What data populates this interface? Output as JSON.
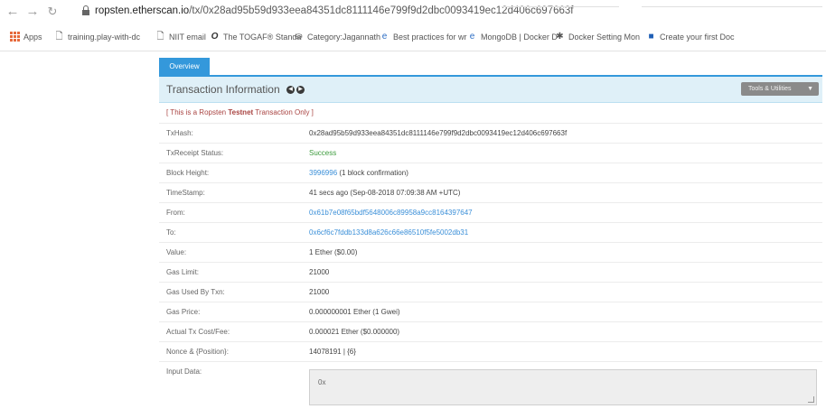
{
  "browser": {
    "url_host": "ropsten.etherscan.io",
    "url_path": "/tx/0x28ad95b59d933eea84351dc8111146e799f9d2dbc0093419ec12d406c697663f",
    "bookmarks": [
      {
        "label": "Apps",
        "icon": "apps-grid-icon"
      },
      {
        "label": "training.play-with-dc",
        "icon": "page-icon"
      },
      {
        "label": "NIIT email",
        "icon": "page-icon"
      },
      {
        "label": "The TOGAF® Standa",
        "icon": "togaf-icon"
      },
      {
        "label": "Category:Jagannath",
        "icon": "wiki-icon"
      },
      {
        "label": "Best practices for wr",
        "icon": "edge-icon"
      },
      {
        "label": "MongoDB | Docker D",
        "icon": "edge-icon"
      },
      {
        "label": "Docker Setting Mon",
        "icon": "docker-icon"
      },
      {
        "label": "Create your first Doc",
        "icon": "blue-square-icon"
      }
    ]
  },
  "tabs": {
    "overview": "Overview"
  },
  "panel": {
    "title": "Transaction Information",
    "tools_label": "Tools & Utilities"
  },
  "notice": {
    "prefix": "[ This is a Ropsten ",
    "bold": "Testnet",
    "suffix": " Transaction Only ]"
  },
  "rows": [
    {
      "label": "TxHash:",
      "value": "0x28ad95b59d933eea84351dc8111146e799f9d2dbc0093419ec12d406c697663f",
      "kind": "text"
    },
    {
      "label": "TxReceipt Status:",
      "value": "Success",
      "kind": "success"
    },
    {
      "label": "Block Height:",
      "value": "3996996",
      "extra": " (1 block confirmation)",
      "kind": "link-extra"
    },
    {
      "label": "TimeStamp:",
      "value": "41 secs ago (Sep-08-2018 07:09:38 AM +UTC)",
      "kind": "text"
    },
    {
      "label": "From:",
      "value": "0x61b7e08f65bdf5648006c89958a9cc8164397647",
      "kind": "link"
    },
    {
      "label": "To:",
      "value": "0x6cf6c7fddb133d8a626c66e86510f5fe5002db31",
      "kind": "link"
    },
    {
      "label": "Value:",
      "value": "1 Ether ($0.00)",
      "kind": "text"
    },
    {
      "label": "Gas Limit:",
      "value": "21000",
      "kind": "text"
    },
    {
      "label": "Gas Used By Txn:",
      "value": "21000",
      "kind": "text"
    },
    {
      "label": "Gas Price:",
      "value": "0.000000001 Ether (1 Gwei)",
      "kind": "text"
    },
    {
      "label": "Actual Tx Cost/Fee:",
      "value": "0.000021 Ether ($0.000000)",
      "kind": "text"
    },
    {
      "label": "Nonce & {Position}:",
      "value": "14078191 | {6}",
      "kind": "text"
    },
    {
      "label": "Input Data:",
      "value": "",
      "kind": "none"
    }
  ],
  "input_data": {
    "value": "0x"
  },
  "colors": {
    "accent": "#3498db",
    "success": "#3c9b3c",
    "link": "#3a8fd8",
    "notice": "#a94442"
  }
}
